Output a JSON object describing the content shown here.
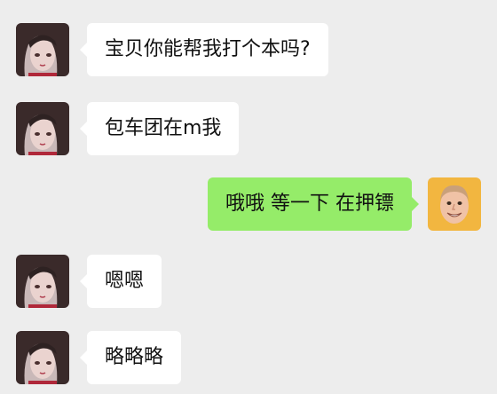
{
  "messages": [
    {
      "side": "left",
      "text": "宝贝你能帮我打个本吗?",
      "avatar": "anime-girl-avatar"
    },
    {
      "side": "left",
      "text": "包车团在m我",
      "avatar": "anime-girl-avatar"
    },
    {
      "side": "right",
      "text": "哦哦  等一下 在押镖",
      "avatar": "man-avatar"
    },
    {
      "side": "left",
      "text": "嗯嗯",
      "avatar": "anime-girl-avatar"
    },
    {
      "side": "left",
      "text": "略略略",
      "avatar": "anime-girl-avatar"
    }
  ],
  "colors": {
    "background": "#ededed",
    "incoming_bubble": "#ffffff",
    "outgoing_bubble": "#95ec69",
    "right_avatar_bg": "#f2b640"
  }
}
